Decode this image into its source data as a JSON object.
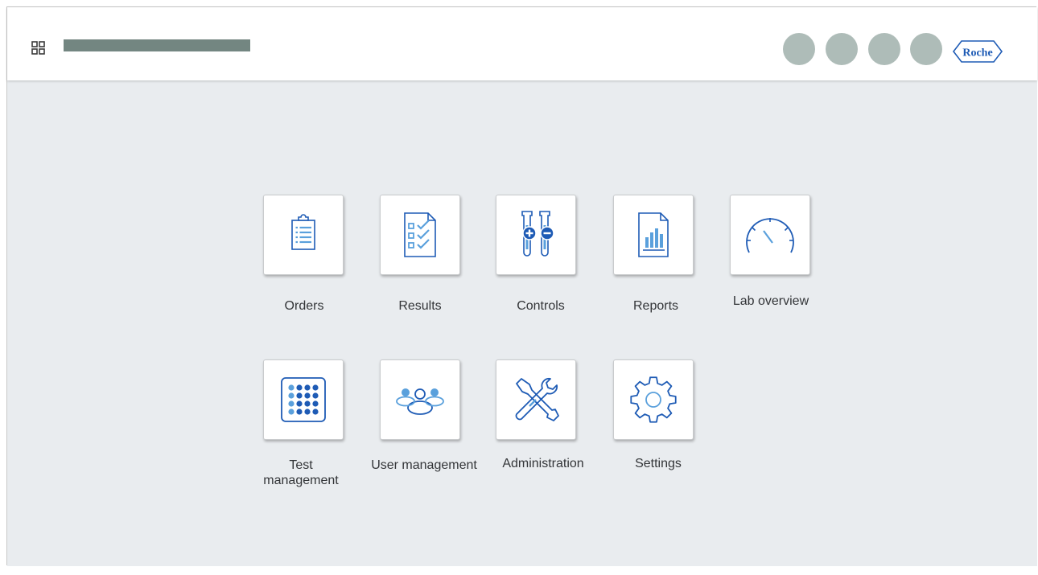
{
  "brand": {
    "logo_text": "Roche",
    "logo_color": "#1e5bb5",
    "icon_color": "#1e5bb5",
    "icon_light_color": "#5aa0dc"
  },
  "header": {
    "app_menu_icon": "grid-icon",
    "title_placeholder_color": "#738681",
    "action_circle_color": "#aebcb8"
  },
  "tiles": {
    "orders": {
      "label": "Orders",
      "icon": "clipboard-list-icon"
    },
    "results": {
      "label": "Results",
      "icon": "checklist-document-icon"
    },
    "controls": {
      "label": "Controls",
      "icon": "test-tubes-plus-minus-icon"
    },
    "reports": {
      "label": "Reports",
      "icon": "bar-chart-document-icon"
    },
    "lab_overview": {
      "label": "Lab overview",
      "icon": "gauge-icon"
    },
    "test_management": {
      "label": "Test\nmanagement",
      "icon": "well-plate-icon"
    },
    "user_management": {
      "label": "User management",
      "icon": "user-group-icon"
    },
    "administration": {
      "label": "Administration",
      "icon": "tools-icon"
    },
    "settings": {
      "label": "Settings",
      "icon": "gear-icon"
    }
  }
}
